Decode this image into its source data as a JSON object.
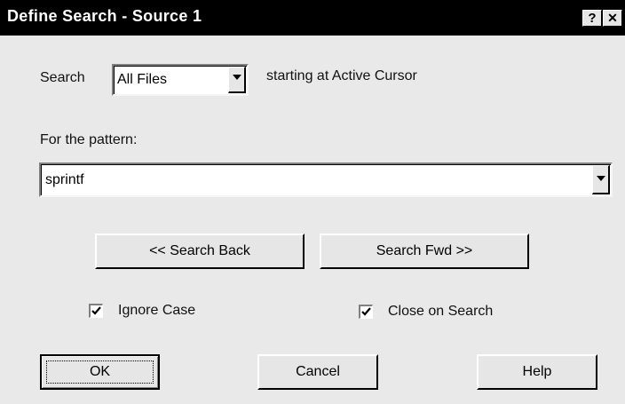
{
  "window": {
    "title": "Define Search - Source 1",
    "help_glyph": "?",
    "close_glyph": "✕"
  },
  "search": {
    "label": "Search",
    "scope_value": "All Files",
    "starting_text": "starting at Active Cursor"
  },
  "pattern": {
    "label": "For the pattern:",
    "value": "sprintf"
  },
  "buttons": {
    "search_back": "<< Search Back",
    "search_fwd": "Search Fwd >>",
    "ok": "OK",
    "cancel": "Cancel",
    "help": "Help"
  },
  "options": {
    "ignore_case": {
      "label": "Ignore Case",
      "checked": true
    },
    "close_on_search": {
      "label": "Close on Search",
      "checked": true
    }
  },
  "icons": {
    "dropdown": "chevron-down-icon",
    "checkmark": "checkmark-icon"
  }
}
